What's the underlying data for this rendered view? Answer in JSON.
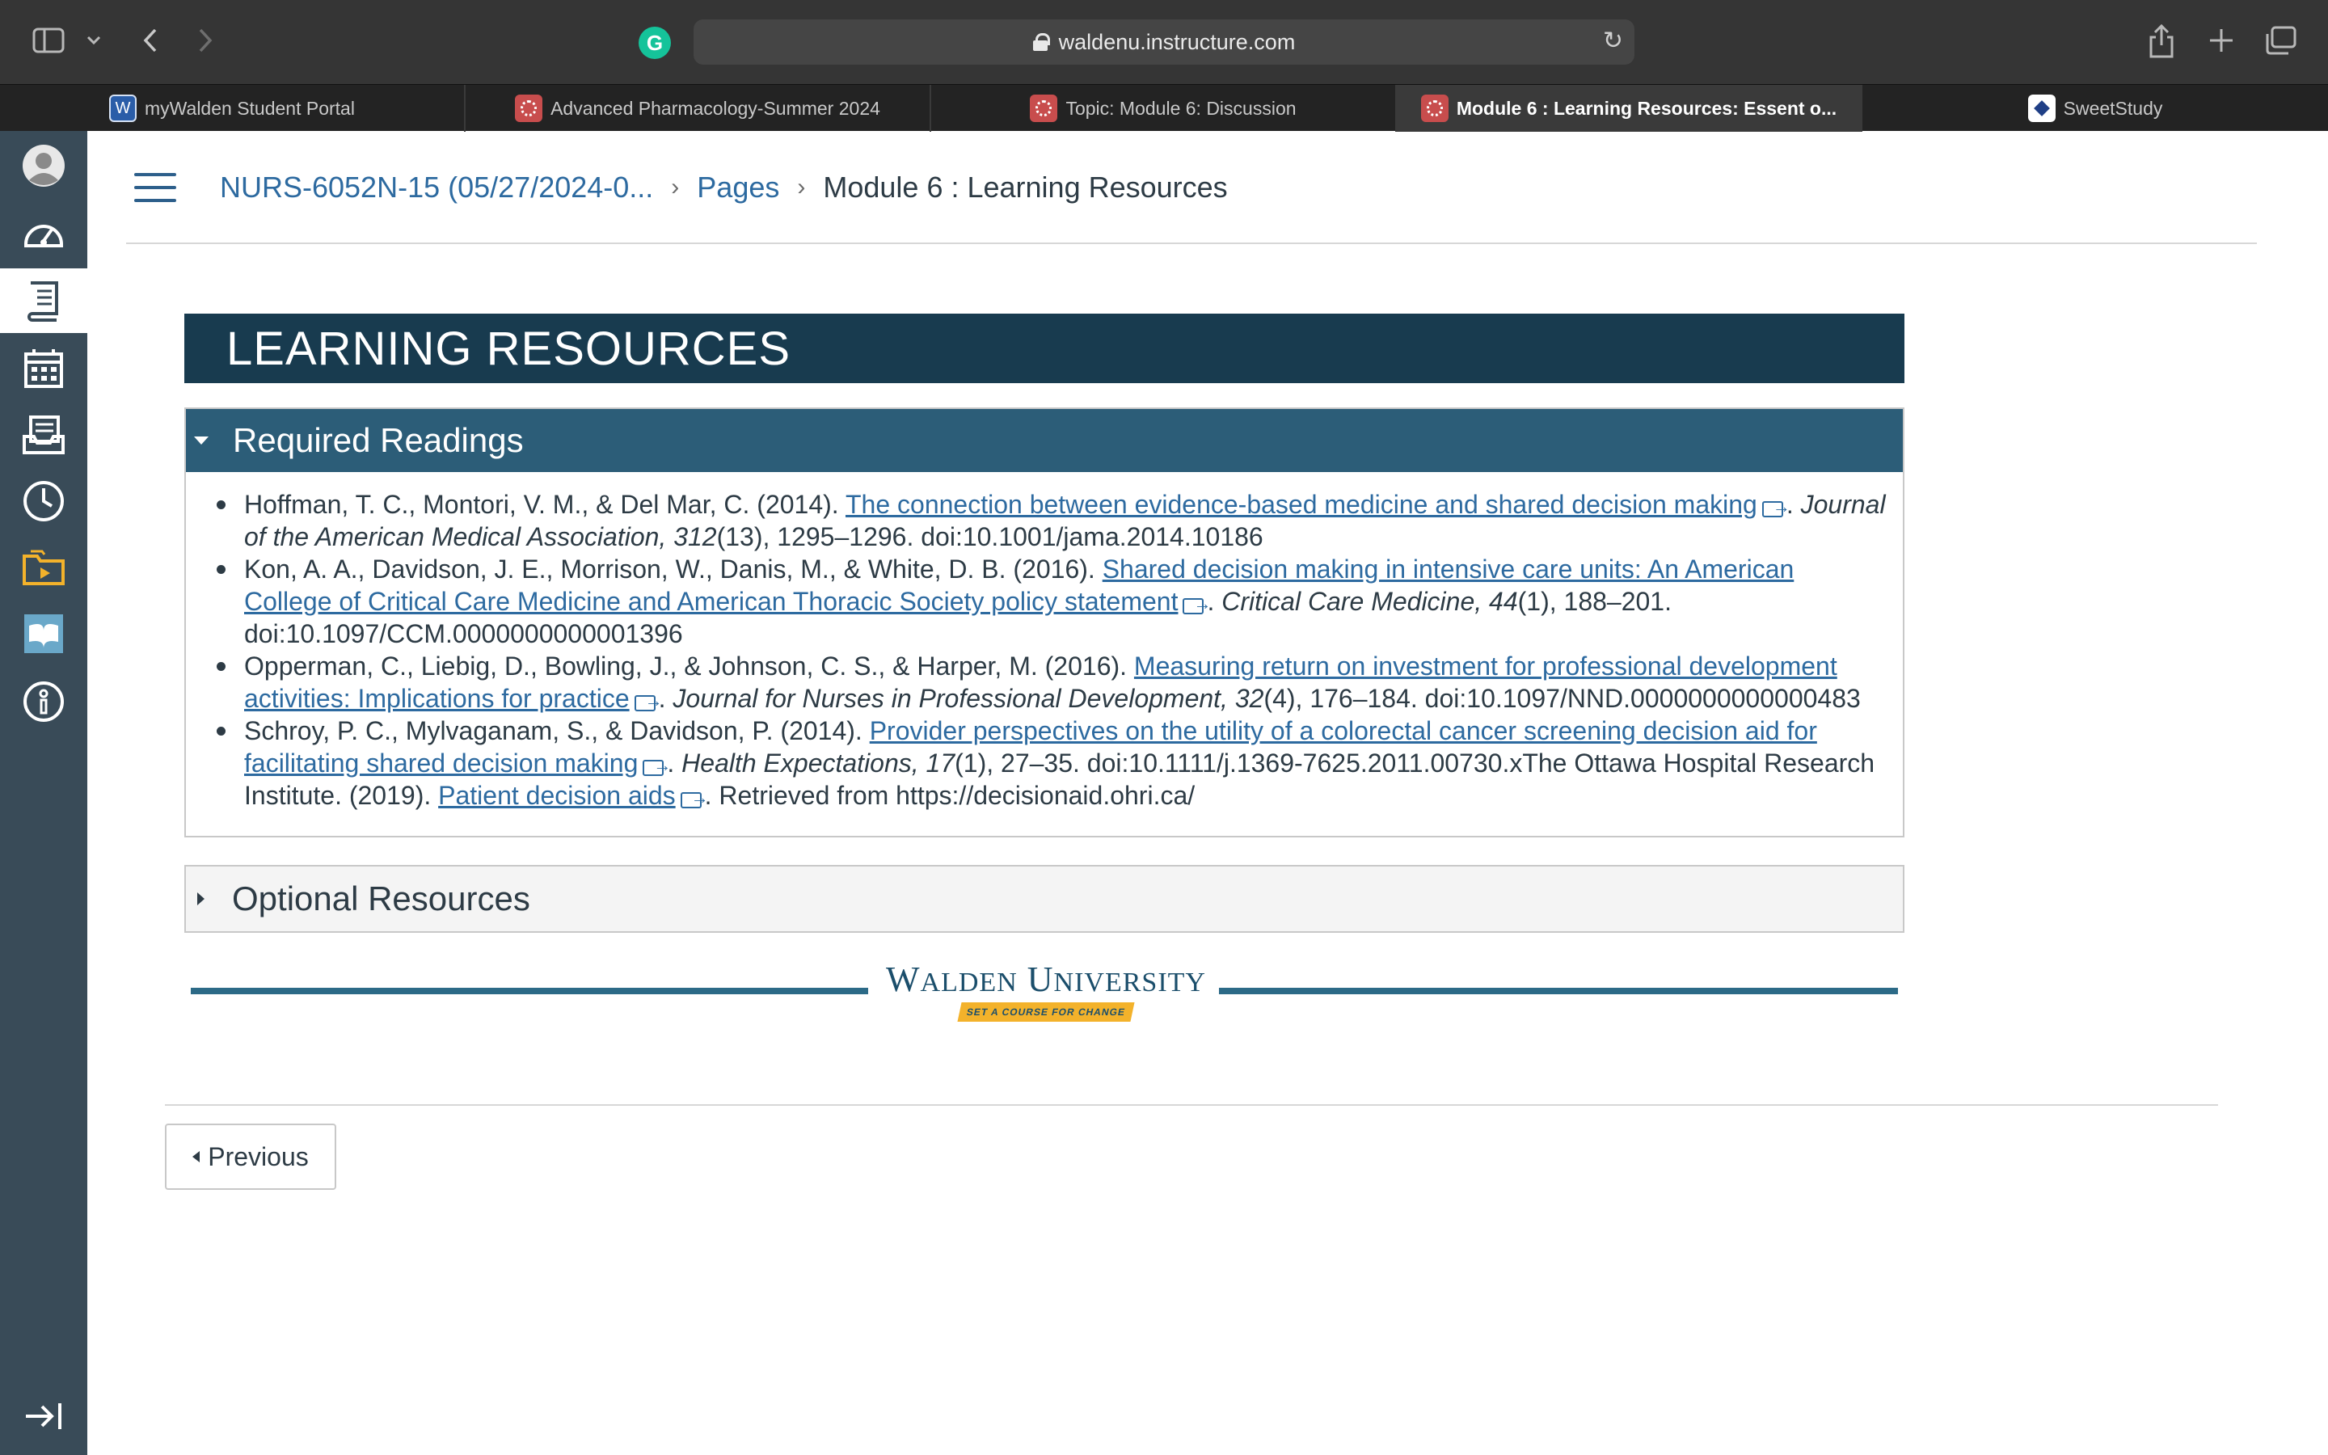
{
  "browser": {
    "url": "waldenu.instructure.com",
    "tabs": [
      {
        "label": "myWalden Student Portal",
        "icon": "walden-favicon",
        "active": false
      },
      {
        "label": "Advanced Pharmacology-Summer 2024",
        "icon": "canvas-favicon",
        "active": false
      },
      {
        "label": "Topic: Module 6: Discussion",
        "icon": "canvas-favicon",
        "active": false
      },
      {
        "label": "Module 6 : Learning Resources: Essent o...",
        "icon": "canvas-favicon",
        "active": true
      },
      {
        "label": "SweetStudy",
        "icon": "sweetstudy-favicon",
        "active": false
      }
    ],
    "grammarly_letter": "G"
  },
  "leftnav": {
    "items": [
      "account-icon",
      "dashboard-icon",
      "courses-icon",
      "calendar-icon",
      "inbox-icon",
      "history-icon",
      "studio-icon",
      "wellness-icon",
      "help-icon"
    ],
    "active_item": "courses-icon",
    "collapse_icon": "collapse-nav-icon"
  },
  "breadcrumb": {
    "course": "NURS-6052N-15 (05/27/2024-0...",
    "section": "Pages",
    "current": "Module 6 : Learning Resources",
    "separator": "›"
  },
  "page": {
    "header": "LEARNING RESOURCES",
    "required": {
      "title": "Required Readings",
      "items": [
        {
          "pre": "Hoffman, T. C., Montori, V. M., & Del Mar, C. (2014). ",
          "link": "The connection between evidence-based medicine and shared decision making",
          "post_sep": ". ",
          "journal": "Journal of the American Medical Association, 312",
          "post": "(13), 1295–1296. doi:10.1001/jama.2014.10186"
        },
        {
          "pre": "Kon, A. A., Davidson, J. E., Morrison, W., Danis, M., & White, D. B. (2016). ",
          "link": "Shared decision making in intensive care units: An American College of Critical Care Medicine and American Thoracic Society policy statement",
          "post_sep": ". ",
          "journal": "Critical Care Medicine, 44",
          "post": "(1), 188–201. doi:10.1097/CCM.0000000000001396"
        },
        {
          "pre": "Opperman, C., Liebig, D., Bowling, J., & Johnson, C. S., & Harper, M. (2016). ",
          "link": "Measuring return on investment for professional development activities: Implications for practice",
          "post_sep": ". ",
          "journal": "Journal for Nurses in Professional Development, 32",
          "post": "(4), 176–184. doi:10.1097/NND.0000000000000483"
        },
        {
          "pre": "Schroy, P. C., Mylvaganam, S., & Davidson, P. (2014). ",
          "link": "Provider perspectives on the utility of a colorectal cancer screening decision aid for facilitating shared decision making",
          "post_sep": ". ",
          "journal": "Health Expectations, 17",
          "post": "(1), 27–35. doi:10.1111/j.1369-7625.2011.00730.xThe Ottawa Hospital Research Institute. (2019). ",
          "link2": "Patient decision aids",
          "post2": ". Retrieved from https://decisionaid.ohri.ca/"
        }
      ]
    },
    "optional": {
      "title": "Optional Resources"
    },
    "logo": {
      "name_first": "W",
      "name_rest": "ALDEN",
      "name_first2": "U",
      "name_rest2": "NIVERSITY",
      "tagline": "SET A COURSE FOR CHANGE"
    },
    "previous_button": "Previous"
  },
  "colors": {
    "nav_bg": "#394b58",
    "header_bg": "#183b4f",
    "section_bg": "#2c5d78",
    "link": "#2d6aa0",
    "logo_gold": "#f3b22b"
  }
}
